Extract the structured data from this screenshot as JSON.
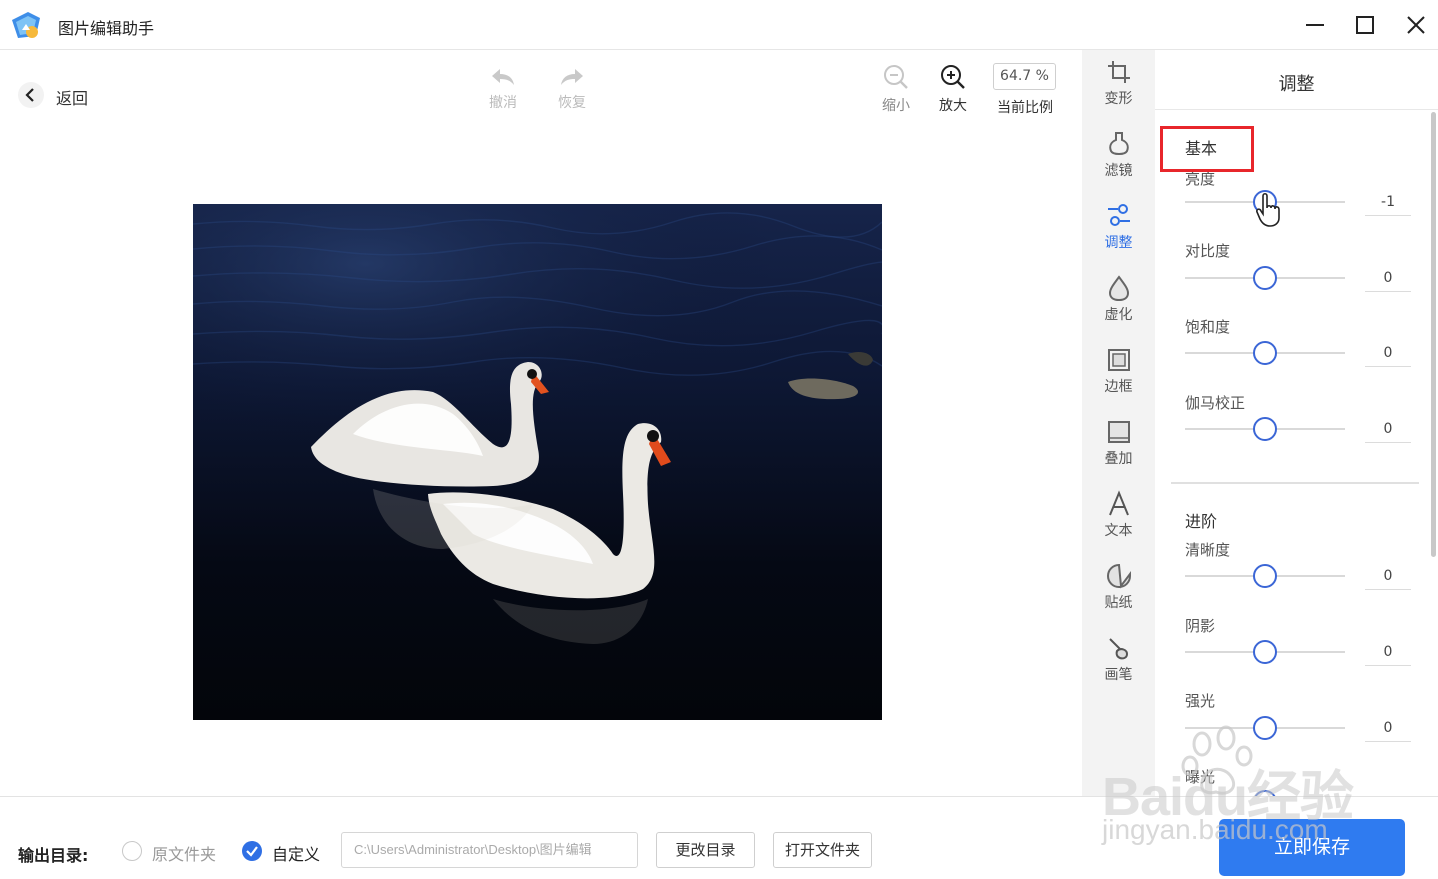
{
  "app": {
    "title": "图片编辑助手"
  },
  "window_controls": [
    "minimize-icon",
    "maximize-icon",
    "close-icon"
  ],
  "toolbar": {
    "back_label": "返回",
    "undo_label": "撤消",
    "redo_label": "恢复",
    "zoom_out_label": "缩小",
    "zoom_in_label": "放大",
    "zoom_value": "64.7 %",
    "zoom_ratio_label": "当前比例"
  },
  "sidebar": {
    "items": [
      {
        "label": "变形",
        "icon": "crop-icon",
        "active": false
      },
      {
        "label": "滤镜",
        "icon": "filter-flask-icon",
        "active": false
      },
      {
        "label": "调整",
        "icon": "adjust-nodes-icon",
        "active": true
      },
      {
        "label": "虚化",
        "icon": "blur-drop-icon",
        "active": false
      },
      {
        "label": "边框",
        "icon": "frame-icon",
        "active": false
      },
      {
        "label": "叠加",
        "icon": "overlay-icon",
        "active": false
      },
      {
        "label": "文本",
        "icon": "text-a-icon",
        "active": false
      },
      {
        "label": "贴纸",
        "icon": "sticker-icon",
        "active": false
      },
      {
        "label": "画笔",
        "icon": "brush-icon",
        "active": false
      }
    ],
    "active_color": "#2f6fe4"
  },
  "panel": {
    "title": "调整",
    "basic": {
      "title": "基本",
      "params": [
        {
          "label": "亮度",
          "value": "-1",
          "level": 0.5
        },
        {
          "label": "对比度",
          "value": "0",
          "level": 0.5
        },
        {
          "label": "饱和度",
          "value": "0",
          "level": 0.5
        },
        {
          "label": "伽马校正",
          "value": "0",
          "level": 0.5
        }
      ]
    },
    "advanced": {
      "title": "进阶",
      "params": [
        {
          "label": "清晰度",
          "value": "0",
          "level": 0.5
        },
        {
          "label": "阴影",
          "value": "0",
          "level": 0.5
        },
        {
          "label": "强光",
          "value": "0",
          "level": 0.5
        },
        {
          "label": "曝光",
          "value": "",
          "level": 0.5
        }
      ]
    },
    "highlight_color": "#e8262b",
    "accent_color": "#3b66d6"
  },
  "output": {
    "label": "输出目录:",
    "option_original": "原文件夹",
    "option_custom": "自定义",
    "selected": "自定义",
    "path": "C:\\Users\\Administrator\\Desktop\\图片编辑",
    "change_dir_label": "更改目录",
    "open_folder_label": "打开文件夹",
    "save_label": "立即保存"
  },
  "watermark": {
    "line1": "Baidu经验",
    "line2": "jingyan.baidu.com"
  },
  "image": {
    "subject": "swans-on-dark-water"
  }
}
